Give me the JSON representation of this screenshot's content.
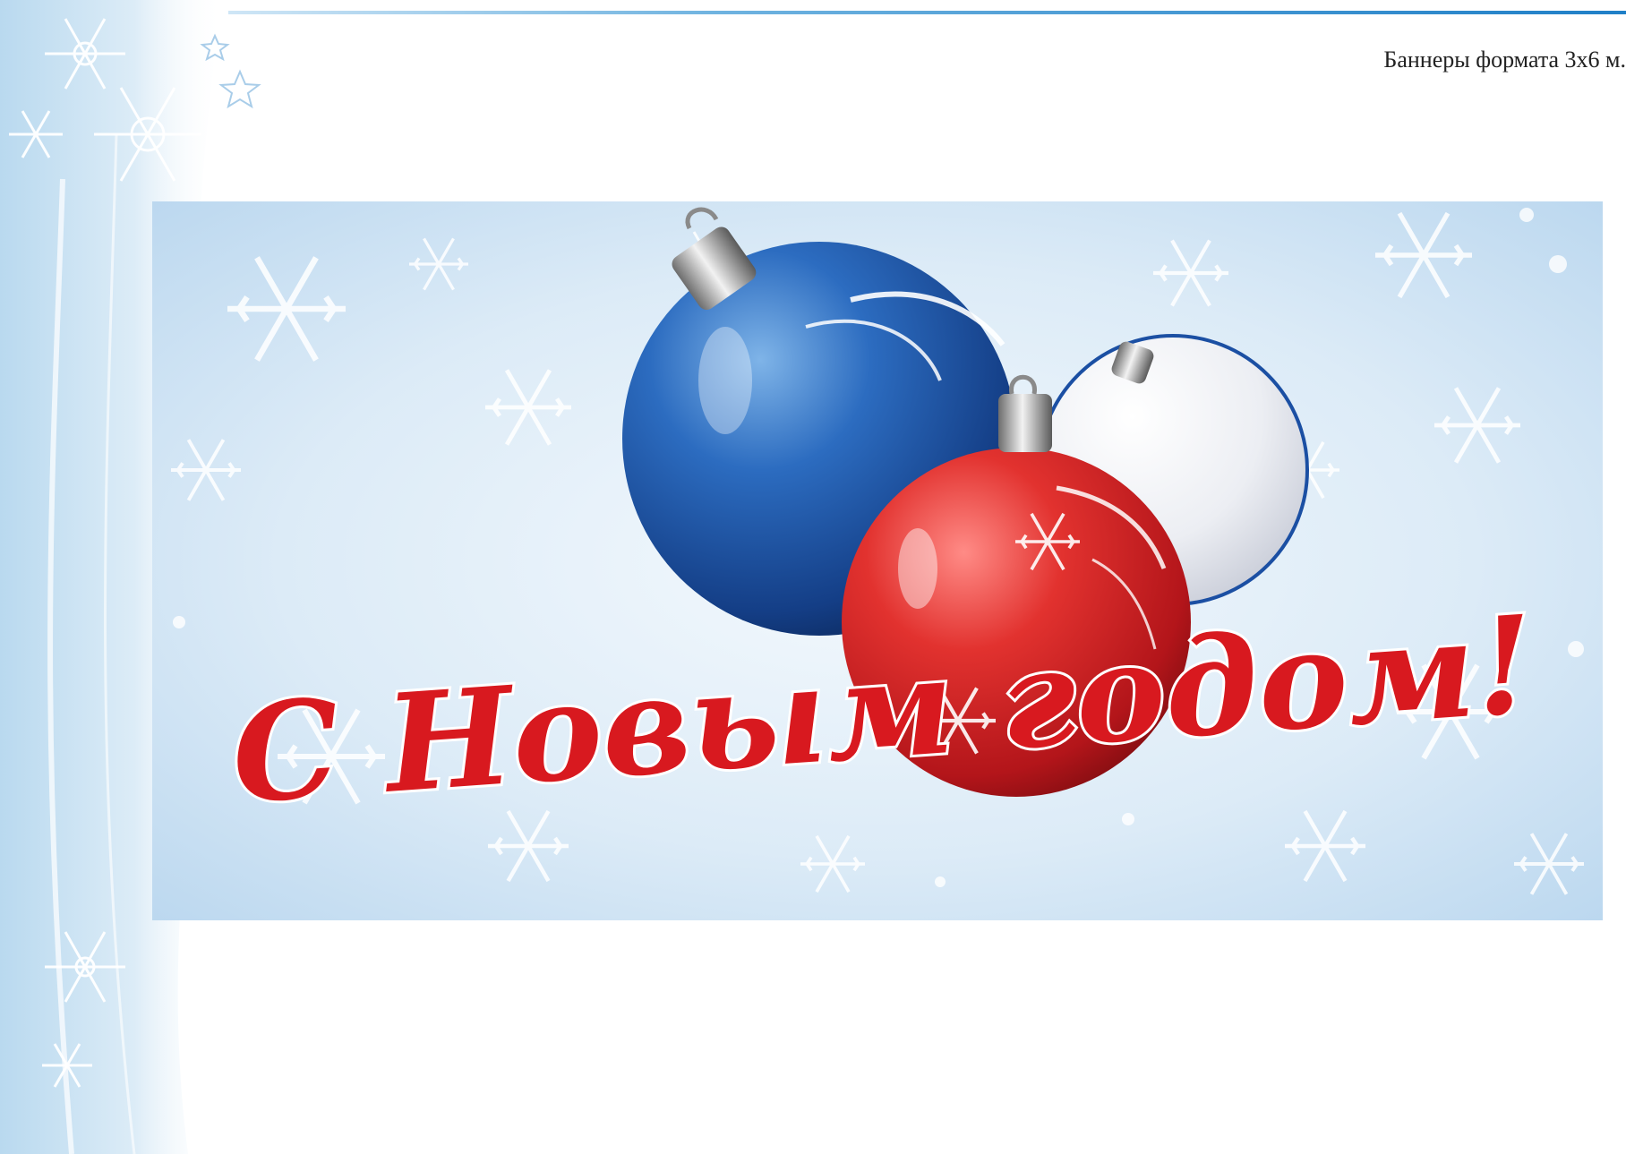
{
  "document": {
    "caption": "Баннеры формата 3х6 м."
  },
  "banner": {
    "greeting": "С Новым годом!",
    "colors": {
      "greeting_red": "#d8191f",
      "sky_blue": "#cfe4f5",
      "ball_blue": "#1b4fa3",
      "ball_red": "#d32025",
      "ball_white": "#eef0f4"
    }
  },
  "icons": [
    "snowflake-icon",
    "star-icon",
    "ornament-ball-icon"
  ]
}
